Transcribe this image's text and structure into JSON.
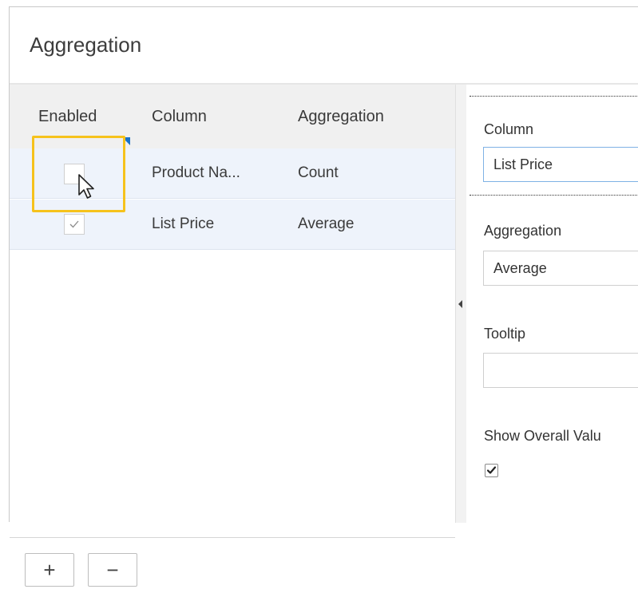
{
  "dialog": {
    "title": "Aggregation"
  },
  "grid": {
    "headers": {
      "enabled": "Enabled",
      "column": "Column",
      "aggregation": "Aggregation"
    },
    "rows": [
      {
        "enabled": false,
        "column": "Product Na...",
        "aggregation": "Count"
      },
      {
        "enabled": true,
        "column": "List Price",
        "aggregation": "Average"
      }
    ],
    "footer": {
      "add_label": "+",
      "remove_label": "−"
    }
  },
  "properties": {
    "column_label": "Column",
    "column_value": "List Price",
    "aggregation_label": "Aggregation",
    "aggregation_value": "Average",
    "tooltip_label": "Tooltip",
    "tooltip_value": "",
    "show_overall_label": "Show Overall Valu",
    "show_overall_checked": true
  },
  "colors": {
    "highlight": "#f6c21c",
    "row_selected": "#eef3fb",
    "header_bg": "#f0f0f0",
    "accent_triangle": "#1a73c9"
  },
  "icons": {
    "cursor": "mouse-pointer-icon",
    "checkmark": "check-icon",
    "splitter": "collapse-left-arrow-icon"
  }
}
